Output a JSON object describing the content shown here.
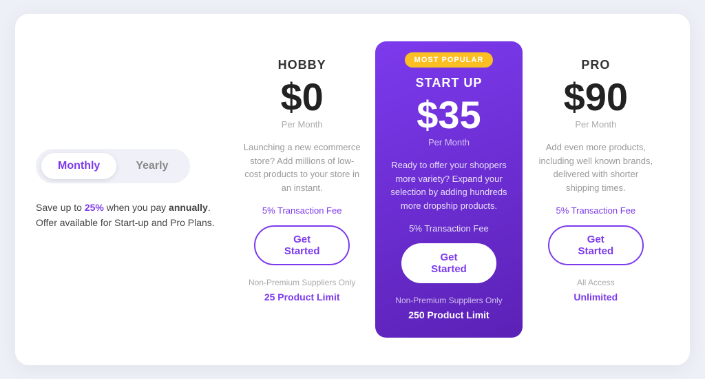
{
  "toggle": {
    "monthly_label": "Monthly",
    "yearly_label": "Yearly",
    "active": "monthly"
  },
  "savings": {
    "line1_prefix": "Save up to ",
    "line1_highlight": "25%",
    "line1_suffix": " when you pay ",
    "line1_bold": "annually",
    "line1_end": ".",
    "line2": "Offer available for Start-up and Pro Plans."
  },
  "plans": [
    {
      "id": "hobby",
      "name": "HOBBY",
      "price": "$0",
      "per_month": "Per Month",
      "desc": "Launching a new ecommerce store? Add millions of low-cost products to your store in an instant.",
      "transaction_fee": "5% Transaction Fee",
      "cta": "Get Started",
      "suppliers": "Non-Premium Suppliers Only",
      "limit": "25 Product Limit",
      "popular": false
    },
    {
      "id": "startup",
      "name": "START UP",
      "price": "$35",
      "per_month": "Per Month",
      "desc": "Ready to offer your shoppers more variety? Expand your selection by adding hundreds more dropship products.",
      "transaction_fee": "5% Transaction Fee",
      "cta": "Get Started",
      "suppliers": "Non-Premium Suppliers Only",
      "limit": "250 Product Limit",
      "popular": true,
      "popular_badge": "MOST POPULAR"
    },
    {
      "id": "pro",
      "name": "PRO",
      "price": "$90",
      "per_month": "Per Month",
      "desc": "Add even more products, including well known brands, delivered with shorter shipping times.",
      "transaction_fee": "5% Transaction Fee",
      "cta": "Get Started",
      "all_access": "All Access",
      "limit": "Unlimited",
      "popular": false
    }
  ]
}
